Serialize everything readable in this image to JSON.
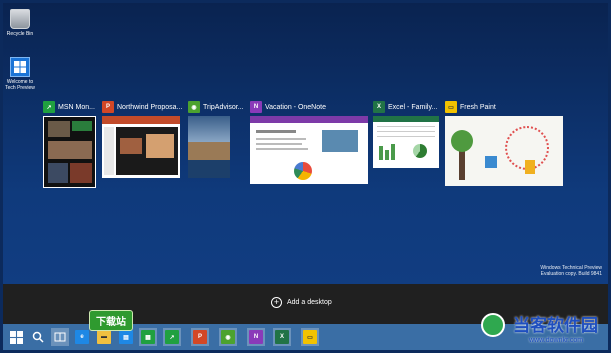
{
  "desktop": {
    "recycle_bin": "Recycle Bin",
    "welcome": "Welcome to Tech Preview"
  },
  "task_view": {
    "windows": [
      {
        "title": "MSN Mon...",
        "icon": "msn-money-icon",
        "color": "#20a040"
      },
      {
        "title": "Northwind Proposa...",
        "icon": "powerpoint-icon",
        "color": "#d24726"
      },
      {
        "title": "TripAdvisor...",
        "icon": "tripadvisor-icon",
        "color": "#4ca22f"
      },
      {
        "title": "Vacation - OneNote",
        "icon": "onenote-icon",
        "color": "#8a3ab9"
      },
      {
        "title": "Excel - Family...",
        "icon": "excel-icon",
        "color": "#217346"
      },
      {
        "title": "Fresh Paint",
        "icon": "fresh-paint-icon",
        "color": "#f2c200"
      }
    ],
    "add_desktop": "Add a desktop"
  },
  "watermark": {
    "line1": "Windows Technical Preview",
    "line2": "Evaluation copy. Build 9841"
  },
  "overlay_brand": {
    "cn_name": "当客软件园",
    "url": "www.downkr.com",
    "badge": "下载站"
  },
  "colors": {
    "taskbar": "#3a6ea5",
    "adddesk_bar": "#202020",
    "desktop_bg": "#0f3a7c"
  }
}
